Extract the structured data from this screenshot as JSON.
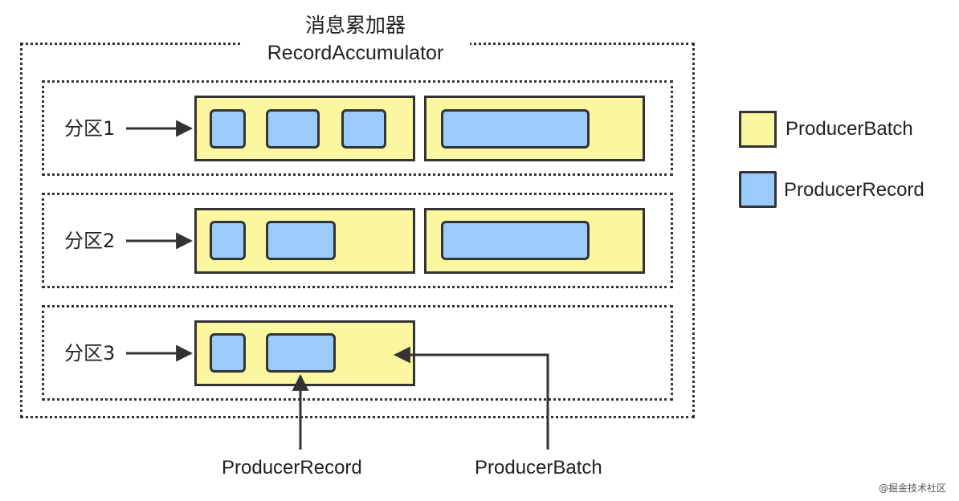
{
  "title": {
    "line1": "消息累加器",
    "line2": "RecordAccumulator"
  },
  "partitions": [
    {
      "label": "分区1"
    },
    {
      "label": "分区2"
    },
    {
      "label": "分区3"
    }
  ],
  "legend": {
    "batch_label": "ProducerBatch",
    "record_label": "ProducerRecord",
    "batch_color": "#fbf7a1",
    "record_color": "#9acbfb"
  },
  "bottom": {
    "record_label": "ProducerRecord",
    "batch_label": "ProducerBatch"
  },
  "watermark": "@掘金技术社区"
}
